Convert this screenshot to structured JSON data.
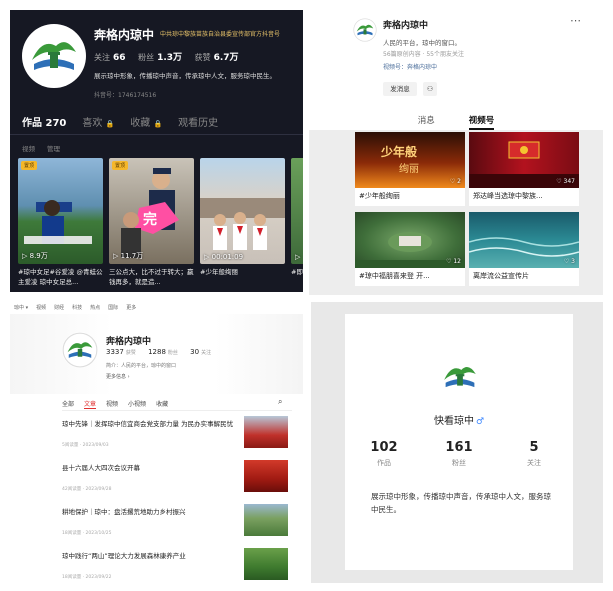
{
  "douyin": {
    "name": "奔格内琼中",
    "verified_text": "中共琼中黎族苗族自治县委宣传部官方抖音号",
    "stats": [
      {
        "label": "关注",
        "value": "66"
      },
      {
        "label": "粉丝",
        "value": "1.3万"
      },
      {
        "label": "获赞",
        "value": "6.7万"
      }
    ],
    "bio": "展示琼中形象，传播琼中声音，传承琼中人文，服务琼中民生。",
    "douyin_id": "抖音号：1746174516",
    "tabs": [
      "作品 270",
      "喜欢",
      "收藏",
      "观看历史"
    ],
    "subtabs": [
      "视频",
      "管理"
    ],
    "videos": [
      {
        "tag": "置顶",
        "plays": "8.9万",
        "caption": "#琼中女足#谷爱凌 @青蛙公主爱凌 琼中女足总..."
      },
      {
        "tag": "置顶",
        "plays": "11.7万",
        "caption": "三公点大，比不过于转大；赢钱再多，就是造..."
      },
      {
        "tag": "",
        "plays": "00:01:09",
        "caption": "#少年般绚丽"
      },
      {
        "tag": "",
        "plays": "",
        "caption": "#即"
      }
    ]
  },
  "channels": {
    "name": "奔格内琼中",
    "more_icon": "⋯",
    "bio": "人民的平台，琼中的窗口。",
    "meta": "56篇原创内容 · 55个朋友关注",
    "channel_label": "视频号：奔格内琼中",
    "message_button": "发消息",
    "tabs": [
      "消息",
      "视频号"
    ],
    "items": [
      {
        "title": "#少年般绚丽",
        "likes": "♡ 2",
        "overlay": "少年般\n绚丽"
      },
      {
        "title": "郑达峰当选琼中黎族...",
        "likes": "♡ 347",
        "overlay": ""
      },
      {
        "title": "#琼中福朋喜来登 开...",
        "likes": "♡ 12",
        "overlay": ""
      },
      {
        "title": "离岸流公益宣传片",
        "likes": "♡ 3",
        "overlay": ""
      }
    ]
  },
  "toutiao": {
    "topnav": [
      "琼中 ▾",
      "视频",
      "财经",
      "科技",
      "热点",
      "国际",
      "更多"
    ],
    "name": "奔格内琼中",
    "stats": [
      {
        "value": "3337",
        "label": "获赞"
      },
      {
        "value": "1288",
        "label": "粉丝"
      },
      {
        "value": "30",
        "label": "关注"
      }
    ],
    "intro": "简介：人民的平台，琼中的窗口",
    "more_info": "更多信息 ›",
    "tabs": [
      "全部",
      "文章",
      "视频",
      "小视频",
      "收藏"
    ],
    "articles": [
      {
        "title": "琼中先锋｜发挥琼中信宜商会党支部力量 为民办实事解民忧",
        "meta": "5阅读量 · 2023/09/03"
      },
      {
        "title": "县十六届人大四次会议开幕",
        "meta": "42阅读量 · 2023/09/28"
      },
      {
        "title": "耕地保护｜琼中：盘活撂荒地助力乡村振兴",
        "meta": "18阅读量 · 2023/10/25"
      },
      {
        "title": "琼中践行“两山”理论大力发展森林康养产业",
        "meta": "18阅读量 · 2023/09/22"
      }
    ]
  },
  "kuaishou": {
    "name": "快看琼中",
    "gender_icon": "♂",
    "stats": [
      {
        "value": "102",
        "label": "作品"
      },
      {
        "value": "161",
        "label": "粉丝"
      },
      {
        "value": "5",
        "label": "关注"
      }
    ],
    "bio": "展示琼中形象，传播琼中声音，传承琼中人文，服务琼中民生。"
  },
  "icons": {
    "lock": "🔒",
    "search": "⌕",
    "play": "▷",
    "add_user": "⚇"
  }
}
